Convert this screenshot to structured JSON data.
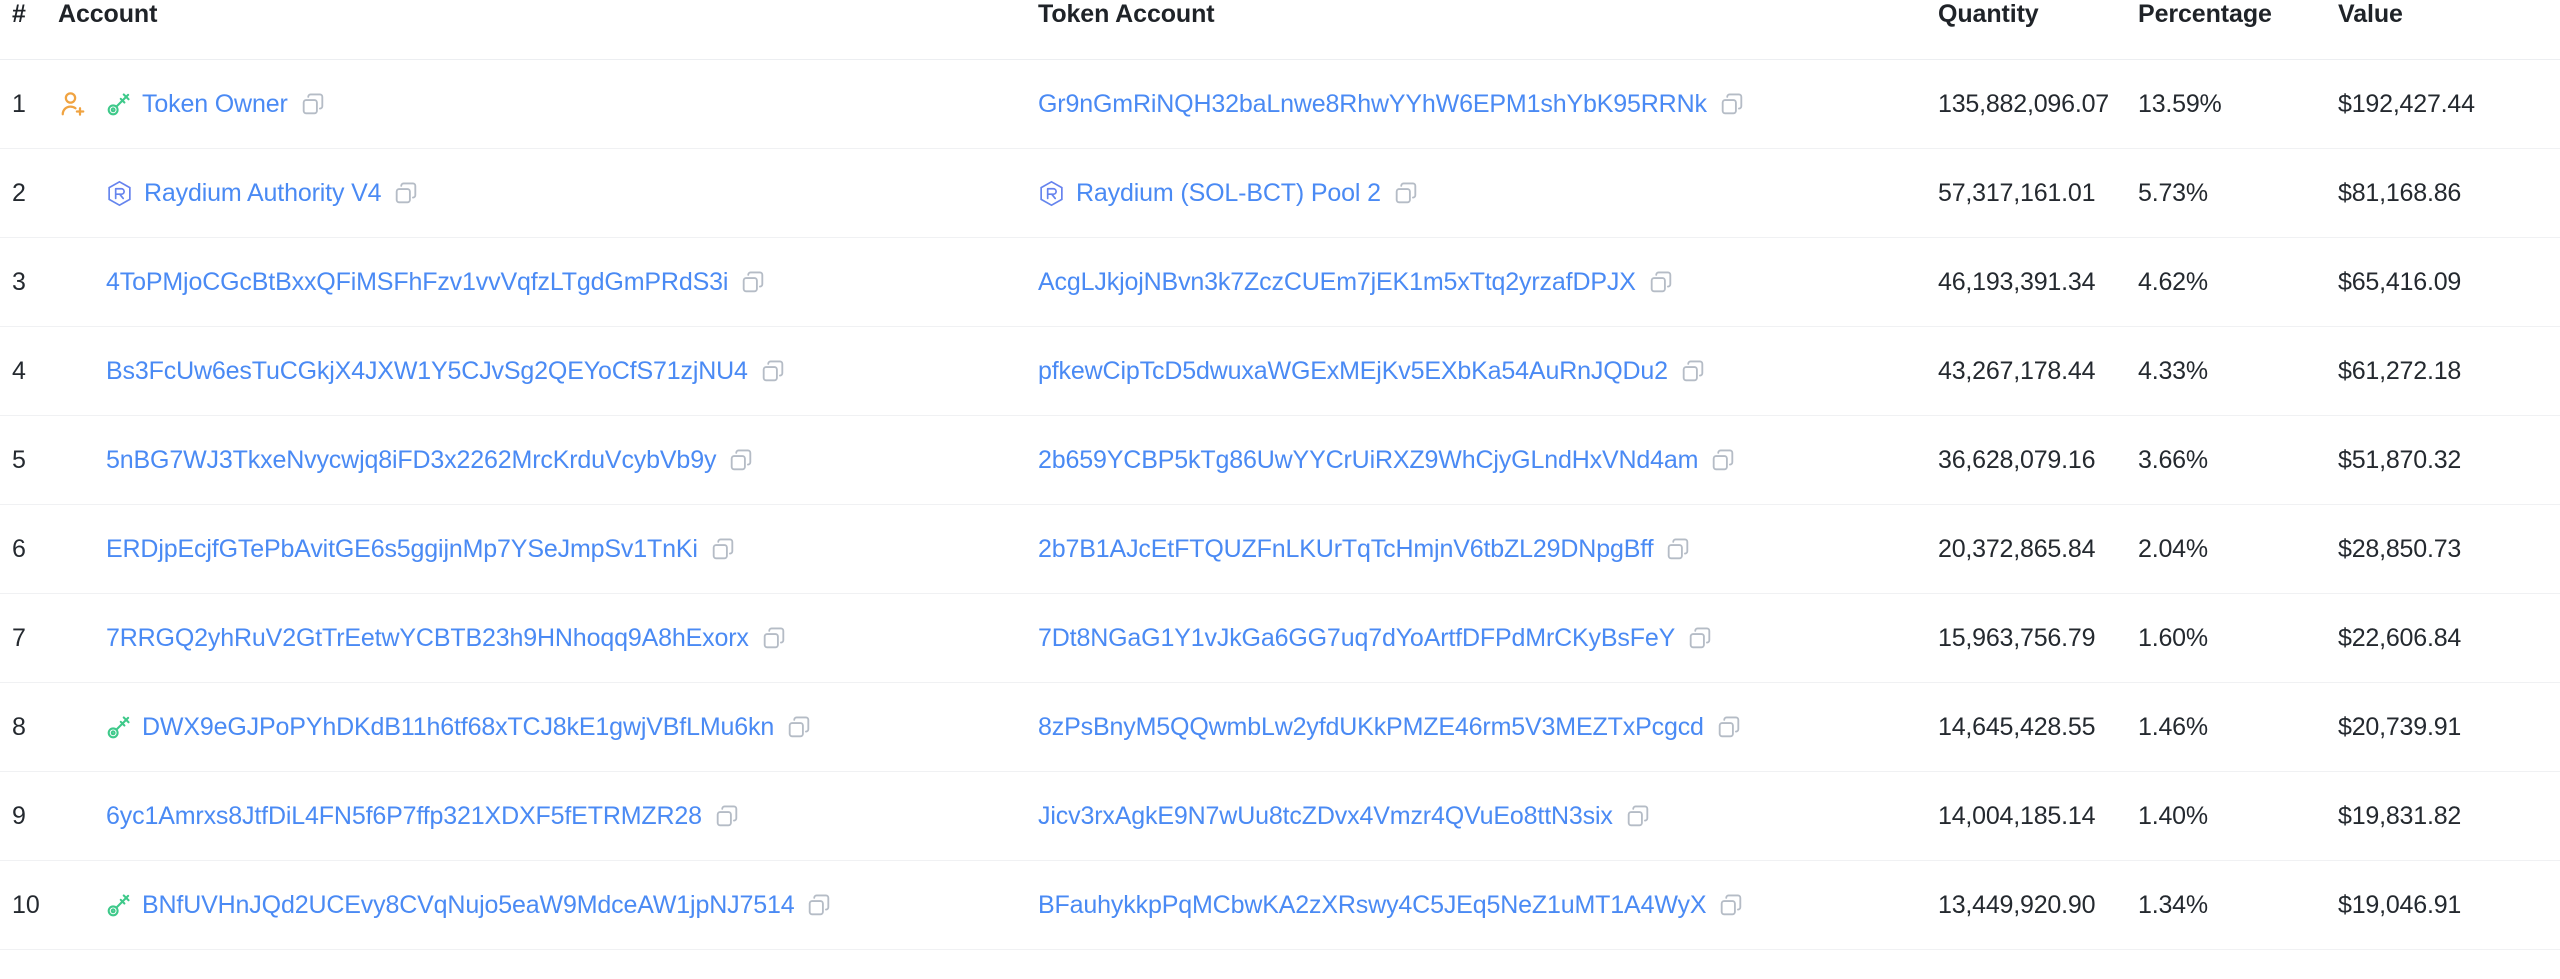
{
  "table": {
    "columns": [
      {
        "key": "rank",
        "label": "#"
      },
      {
        "key": "account",
        "label": "Account"
      },
      {
        "key": "token",
        "label": "Token Account"
      },
      {
        "key": "qty",
        "label": "Quantity"
      },
      {
        "key": "pct",
        "label": "Percentage"
      },
      {
        "key": "value",
        "label": "Value"
      }
    ],
    "rows": [
      {
        "rank": "1",
        "account_badge": "user-plus-icon",
        "account_icon": "key-icon",
        "account_label": "Token Owner",
        "token_icon": null,
        "token_label": "Gr9nGmRiNQH32baLnwe8RhwYYhW6EPM1shYbK95RRNk",
        "qty": "135,882,096.07",
        "pct": "13.59%",
        "value": "$192,427.44"
      },
      {
        "rank": "2",
        "account_badge": null,
        "account_icon": "raydium-icon",
        "account_label": "Raydium Authority V4",
        "token_icon": "raydium-icon",
        "token_label": "Raydium (SOL-BCT) Pool 2",
        "qty": "57,317,161.01",
        "pct": "5.73%",
        "value": "$81,168.86"
      },
      {
        "rank": "3",
        "account_badge": null,
        "account_icon": null,
        "account_label": "4ToPMjoCGcBtBxxQFiMSFhFzv1vvVqfzLTgdGmPRdS3i",
        "token_icon": null,
        "token_label": "AcgLJkjojNBvn3k7ZczCUEm7jEK1m5xTtq2yrzafDPJX",
        "qty": "46,193,391.34",
        "pct": "4.62%",
        "value": "$65,416.09"
      },
      {
        "rank": "4",
        "account_badge": null,
        "account_icon": null,
        "account_label": "Bs3FcUw6esTuCGkjX4JXW1Y5CJvSg2QEYoCfS71zjNU4",
        "token_icon": null,
        "token_label": "pfkewCipTcD5dwuxaWGExMEjKv5EXbKa54AuRnJQDu2",
        "qty": "43,267,178.44",
        "pct": "4.33%",
        "value": "$61,272.18"
      },
      {
        "rank": "5",
        "account_badge": null,
        "account_icon": null,
        "account_label": "5nBG7WJ3TkxeNvycwjq8iFD3x2262MrcKrduVcybVb9y",
        "token_icon": null,
        "token_label": "2b659YCBP5kTg86UwYYCrUiRXZ9WhCjyGLndHxVNd4am",
        "qty": "36,628,079.16",
        "pct": "3.66%",
        "value": "$51,870.32"
      },
      {
        "rank": "6",
        "account_badge": null,
        "account_icon": null,
        "account_label": "ERDjpEcjfGTePbAvitGE6s5ggijnMp7YSeJmpSv1TnKi",
        "token_icon": null,
        "token_label": "2b7B1AJcEtFTQUZFnLKUrTqTcHmjnV6tbZL29DNpgBff",
        "qty": "20,372,865.84",
        "pct": "2.04%",
        "value": "$28,850.73"
      },
      {
        "rank": "7",
        "account_badge": null,
        "account_icon": null,
        "account_label": "7RRGQ2yhRuV2GtTrEetwYCBTB23h9HNhoqq9A8hExorx",
        "token_icon": null,
        "token_label": "7Dt8NGaG1Y1vJkGa6GG7uq7dYoArtfDFPdMrCKyBsFeY",
        "qty": "15,963,756.79",
        "pct": "1.60%",
        "value": "$22,606.84"
      },
      {
        "rank": "8",
        "account_badge": null,
        "account_icon": "key-icon",
        "account_label": "DWX9eGJPoPYhDKdB11h6tf68xTCJ8kE1gwjVBfLMu6kn",
        "token_icon": null,
        "token_label": "8zPsBnyM5QQwmbLw2yfdUKkPMZE46rm5V3MEZTxPcgcd",
        "qty": "14,645,428.55",
        "pct": "1.46%",
        "value": "$20,739.91"
      },
      {
        "rank": "9",
        "account_badge": null,
        "account_icon": null,
        "account_label": "6yc1Amrxs8JtfDiL4FN5f6P7ffp321XDXF5fETRMZR28",
        "token_icon": null,
        "token_label": "Jicv3rxAgkE9N7wUu8tcZDvx4Vmzr4QVuEo8ttN3six",
        "qty": "14,004,185.14",
        "pct": "1.40%",
        "value": "$19,831.82"
      },
      {
        "rank": "10",
        "account_badge": null,
        "account_icon": "key-icon",
        "account_label": "BNfUVHnJQd2UCEvy8CVqNujo5eaW9MdceAW1jpNJ7514",
        "token_icon": null,
        "token_label": "BFauhykkpPqMCbwKA2zXRswy4C5JEq5NeZ1uMT1A4WyX",
        "qty": "13,449,920.90",
        "pct": "1.34%",
        "value": "$19,046.91"
      }
    ]
  },
  "colors": {
    "link": "#4a8af4",
    "text": "#24292f",
    "header_text": "#1f2328",
    "row_border": "#f0f1f3",
    "copy_icon": "#b5bcc6",
    "key_icon": "#3ec98a",
    "user_plus_icon": "#f0a341",
    "raydium_from": "#39d0d8",
    "raydium_to": "#a259ff"
  },
  "icons": {
    "user_plus": "user-plus-icon",
    "key": "key-icon",
    "raydium": "raydium-icon",
    "copy": "copy-icon"
  }
}
